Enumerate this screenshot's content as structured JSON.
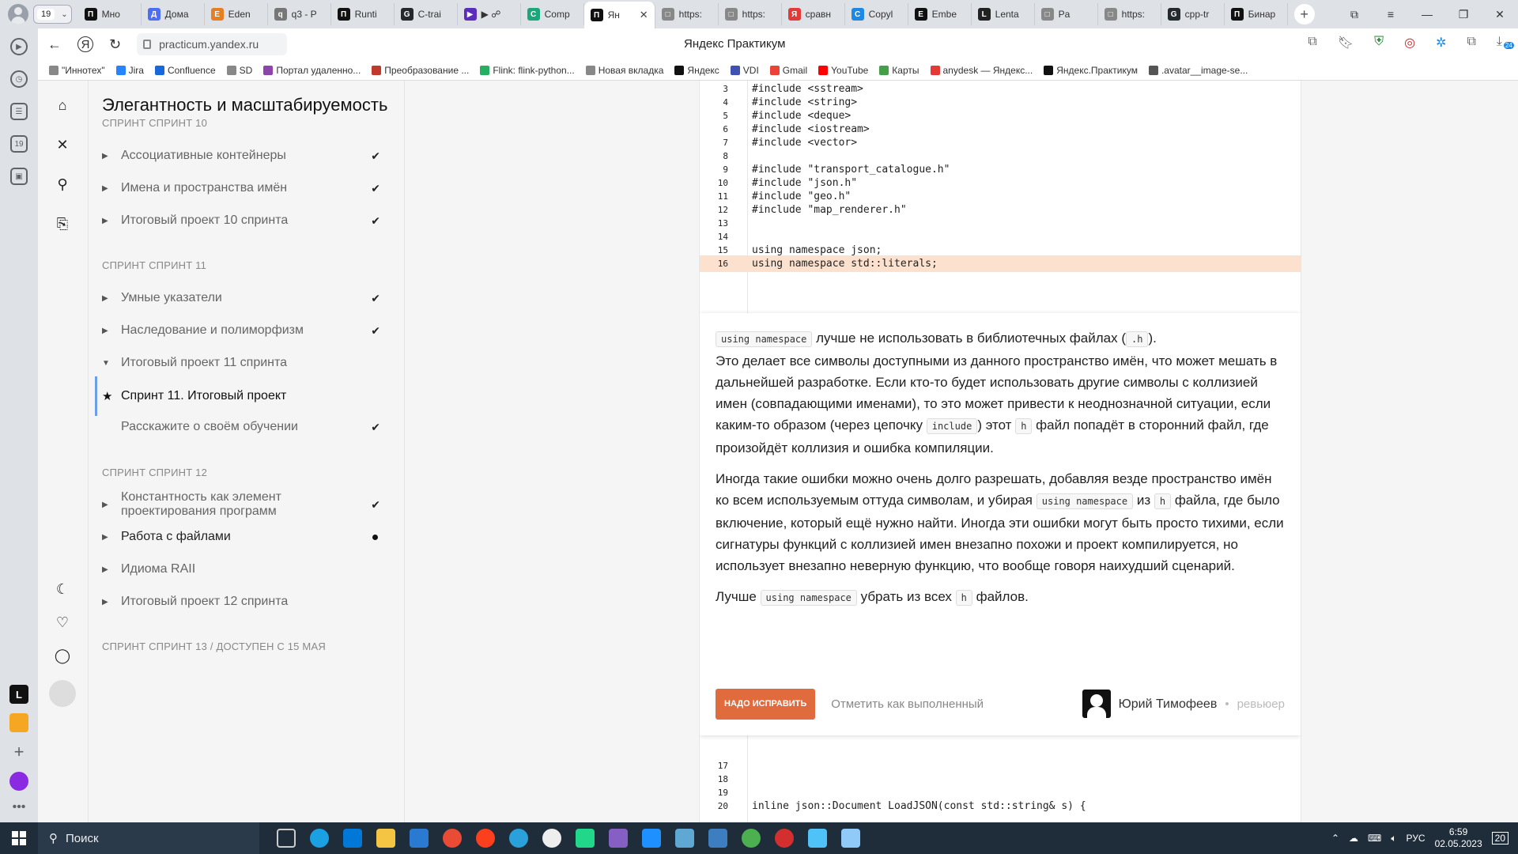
{
  "browser": {
    "tab_group_count": "19",
    "tabs": [
      {
        "label": "Мно",
        "color": "#111111",
        "glyph": "П"
      },
      {
        "label": "Дома",
        "color": "#4c6ef5",
        "glyph": "Д"
      },
      {
        "label": "Eden",
        "color": "#e67e22",
        "glyph": "E"
      },
      {
        "label": "q3 - P",
        "color": "#777777",
        "glyph": "q"
      },
      {
        "label": "Runti",
        "color": "#111111",
        "glyph": "П"
      },
      {
        "label": "C-trai",
        "color": "#24292e",
        "glyph": "G"
      },
      {
        "label": "▶ ☍",
        "color": "#5b2dbd",
        "glyph": "▶"
      },
      {
        "label": "Comp",
        "color": "#1aa87a",
        "glyph": "C"
      },
      {
        "label": "Ян",
        "color": "#111111",
        "glyph": "П",
        "active": true
      },
      {
        "label": "https:",
        "color": "#888888",
        "glyph": "□"
      },
      {
        "label": "https:",
        "color": "#888888",
        "glyph": "□"
      },
      {
        "label": "сравн",
        "color": "#e53935",
        "glyph": "Я"
      },
      {
        "label": "Copyl",
        "color": "#1e88e5",
        "glyph": "C"
      },
      {
        "label": "Embe",
        "color": "#111111",
        "glyph": "E"
      },
      {
        "label": "Lenta",
        "color": "#222222",
        "glyph": "L"
      },
      {
        "label": "Pa",
        "color": "#888888",
        "glyph": "□"
      },
      {
        "label": "https:",
        "color": "#888888",
        "glyph": "□"
      },
      {
        "label": "cpp-tr",
        "color": "#24292e",
        "glyph": "G"
      },
      {
        "label": "Бинар",
        "color": "#111111",
        "glyph": "П"
      }
    ],
    "url": "practicum.yandex.ru",
    "page_title": "Яндекс Практикум",
    "bookmarks": [
      {
        "label": "\"Иннотех\"",
        "color": "#888888"
      },
      {
        "label": "Jira",
        "color": "#2684ff"
      },
      {
        "label": "Confluence",
        "color": "#1868db"
      },
      {
        "label": "SD",
        "color": "#888888"
      },
      {
        "label": "Портал удаленно...",
        "color": "#8e44ad"
      },
      {
        "label": "Преобразование ...",
        "color": "#c0392b"
      },
      {
        "label": "Flink: flink-python...",
        "color": "#27ae60"
      },
      {
        "label": "Новая вкладка",
        "color": "#888888"
      },
      {
        "label": "Яндекс",
        "color": "#111111"
      },
      {
        "label": "VDI",
        "color": "#3f51b5"
      },
      {
        "label": "Gmail",
        "color": "#ea4335"
      },
      {
        "label": "YouTube",
        "color": "#ff0000"
      },
      {
        "label": "Карты",
        "color": "#43a047"
      },
      {
        "label": "anydesk — Яндекс...",
        "color": "#e53935"
      },
      {
        "label": "Яндекс.Практикум",
        "color": "#111111"
      },
      {
        "label": ".avatar__image-se...",
        "color": "#555555"
      }
    ],
    "rail_badge": "19",
    "extension_badge": "24"
  },
  "toc": {
    "title": "Элегантность и масштабируемость",
    "sections": [
      {
        "header": "СПРИНТ СПРИНТ 10",
        "lessons": [
          {
            "label": "Ассоциативные контейнеры",
            "done": "✔"
          },
          {
            "label": "Имена и пространства имён",
            "done": "✔"
          },
          {
            "label": "Итоговый проект 10 спринта",
            "done": "✔"
          }
        ]
      },
      {
        "header": "СПРИНТ СПРИНТ 11",
        "lessons": [
          {
            "label": "Умные указатели",
            "done": "✔"
          },
          {
            "label": "Наследование и полиморфизм",
            "done": "✔"
          },
          {
            "label": "Итоговый проект 11 спринта",
            "done": ""
          },
          {
            "label": "Спринт 11. Итоговый проект",
            "done": ""
          },
          {
            "label": "Расскажите о своём обучении",
            "done": "✔"
          }
        ]
      },
      {
        "header": "СПРИНТ СПРИНТ 12",
        "lessons": [
          {
            "label": "Константность как элемент проектирования программ",
            "done": "✔"
          },
          {
            "label": "Работа с файлами",
            "done": ""
          },
          {
            "label": "Идиома RAII",
            "done": ""
          },
          {
            "label": "Итоговый проект 12 спринта",
            "done": ""
          }
        ]
      },
      {
        "header": "СПРИНТ СПРИНТ 13 / ДОСТУПЕН С 15 МАЯ",
        "lessons": []
      }
    ]
  },
  "code": {
    "lines_top": [
      {
        "n": "3",
        "text": "#include <sstream>"
      },
      {
        "n": "4",
        "text": "#include <string>"
      },
      {
        "n": "5",
        "text": "#include <deque>"
      },
      {
        "n": "6",
        "text": "#include <iostream>"
      },
      {
        "n": "7",
        "text": "#include <vector>"
      },
      {
        "n": "8",
        "text": ""
      },
      {
        "n": "9",
        "text": "#include \"transport_catalogue.h\""
      },
      {
        "n": "10",
        "text": "#include \"json.h\""
      },
      {
        "n": "11",
        "text": "#include \"geo.h\""
      },
      {
        "n": "12",
        "text": "#include \"map_renderer.h\""
      },
      {
        "n": "13",
        "text": ""
      },
      {
        "n": "14",
        "text": ""
      },
      {
        "n": "15",
        "text": "using namespace json;"
      },
      {
        "n": "16",
        "text": "using namespace std::literals;"
      }
    ],
    "lines_bottom": [
      {
        "n": "17",
        "text": ""
      },
      {
        "n": "18",
        "text": ""
      },
      {
        "n": "19",
        "text": ""
      },
      {
        "n": "20",
        "text": "inline json::Document LoadJSON(const std::string& s) {"
      }
    ]
  },
  "comment": {
    "p1_code1": "using namespace",
    "p1_text1": " лучше не использовать в библиотечных файлах (",
    "p1_code2": ".h",
    "p1_text2": ").",
    "p1_text3": "Это делает все символы доступными из данного пространство имён, что может мешать в дальнейшей разработке. Если кто-то будет использовать другие символы с коллизией имен (совпадающими именами), то это может привести к неоднозначной ситуации, если каким-то образом (через цепочку ",
    "p1_code3": "include",
    "p1_text4": ") этот ",
    "p1_code4": "h",
    "p1_text5": " файл попадёт  в сторонний файл, где произойдёт коллизия и ошибка компиляции.",
    "p2_text1": "Иногда такие ошибки можно очень долго разрешать, добавляя везде пространство имён ко всем используемым оттуда символам, и убирая ",
    "p2_code1": "using namespace",
    "p2_text2": " из ",
    "p2_code2": "h",
    "p2_text3": " файла, где было включение, который ещё нужно найти. Иногда эти ошибки могут быть просто тихими, если сигнатуры функций с коллизией имен внезапно похожи и проект компилируется, но использует внезапно неверную функцию, что вообще говоря наихудший сценарий.",
    "p3_text1": "Лучше ",
    "p3_code1": "using namespace",
    "p3_text2": " убрать из всех ",
    "p3_code2": "h",
    "p3_text3": " файлов.",
    "fix_button": "НАДО ИСПРАВИТЬ",
    "mark_done": "Отметить как выполненный",
    "reviewer_name": "Юрий Тимофеев",
    "reviewer_sep": "•",
    "reviewer_role": "ревьюер"
  },
  "taskbar": {
    "search_label": "Поиск",
    "lang": "РУС",
    "time": "6:59",
    "date": "02.05.2023",
    "notif_count": "20"
  }
}
